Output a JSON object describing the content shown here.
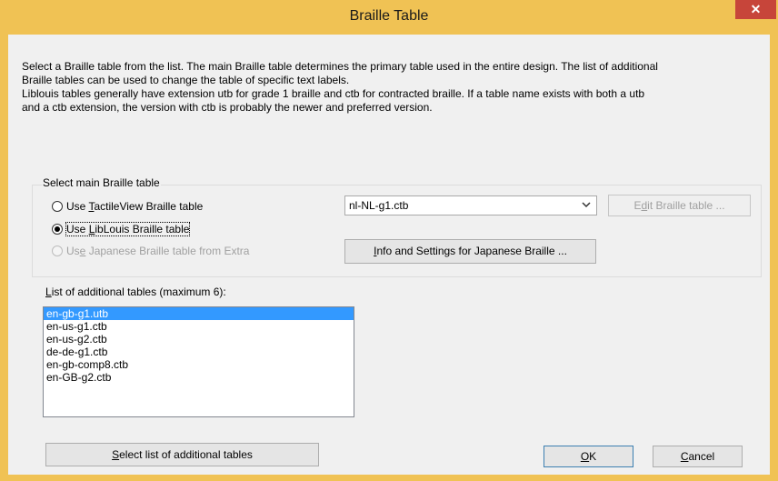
{
  "window": {
    "title": "Braille Table",
    "close_symbol": "✕"
  },
  "intro": {
    "lines": [
      "Select a Braille table from the list. The main Braille table determines the primary table used in the entire design. The list of additional",
      "Braille tables can be used to change the table of specific text labels.",
      "Liblouis tables generally have extension utb for grade 1 braille and ctb for contracted braille. If a table name exists with both a utb",
      "and a ctb extension, the version with ctb is probably the newer and preferred version."
    ]
  },
  "main_group": {
    "legend": "Select main Braille table",
    "radio_tactileview": {
      "pre": "Use ",
      "mnemonic": "T",
      "post": "actileView Braille table",
      "checked": false
    },
    "radio_liblouis": {
      "pre": "Use ",
      "mnemonic": "L",
      "post": "ibLouis Braille table",
      "checked": true
    },
    "radio_japanese": {
      "pre": "Us",
      "mnemonic": "e",
      "post": " Japanese Braille table from Extra",
      "checked": false,
      "disabled": true
    },
    "table_select": {
      "value": "nl-NL-g1.ctb"
    },
    "edit_button": {
      "pre": "E",
      "mnemonic": "d",
      "post": "it Braille table ...",
      "disabled": true
    },
    "info_button": {
      "pre": "",
      "mnemonic": "I",
      "post": "nfo and Settings for Japanese Braille ..."
    }
  },
  "additional": {
    "label_pre": "",
    "label_mnemonic": "L",
    "label_post": "ist of additional tables (maximum 6):",
    "items": [
      "en-gb-g1.utb",
      "en-us-g1.ctb",
      "en-us-g2.ctb",
      "de-de-g1.ctb",
      "en-gb-comp8.ctb",
      "en-GB-g2.ctb"
    ],
    "selected_index": 0
  },
  "footer": {
    "select_list_button": {
      "pre": "",
      "mnemonic": "S",
      "post": "elect list of additional tables"
    },
    "ok_button": {
      "pre": "",
      "mnemonic": "O",
      "post": "K"
    },
    "cancel_button": {
      "pre": "",
      "mnemonic": "C",
      "post": "ancel"
    }
  },
  "colors": {
    "titlebar": "#f0c254",
    "close": "#c7453a",
    "selection": "#3399ff",
    "face": "#f0f0f0"
  }
}
